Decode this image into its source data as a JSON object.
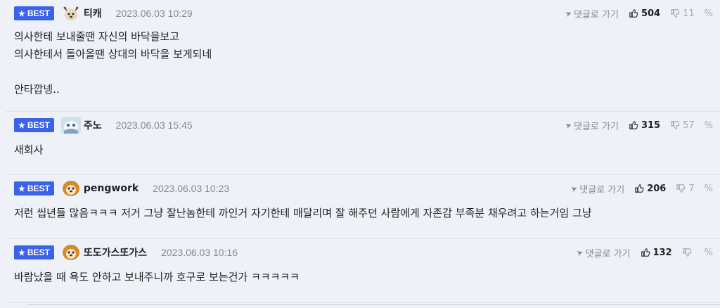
{
  "comments": [
    {
      "badge": "BEST",
      "nickname": "티캐",
      "date": "2023.06.03 10:29",
      "reply_label": "댓글로 가기",
      "likes": "504",
      "dislikes": "11",
      "body": "의사한테 보내줄땐 자신의 바닥을보고\n의사한테서 돌아올땐 상대의 바닥을 보게되네\n\n안타깝넹.."
    },
    {
      "badge": "BEST",
      "nickname": "주노",
      "date": "2023.06.03 15:45",
      "reply_label": "댓글로 가기",
      "likes": "315",
      "dislikes": "57",
      "body": "새회사"
    },
    {
      "badge": "BEST",
      "nickname": "pengwork",
      "date": "2023.06.03 10:23",
      "reply_label": "댓글로 가기",
      "likes": "206",
      "dislikes": "7",
      "body": "저런 씹년들 많음ㅋㅋㅋ 저거 그냥 잘난놈한테 까인거 자기한테 매달리며 잘 해주던 사람에게 자존감 부족분 채우려고 하는거임 그냥"
    },
    {
      "badge": "BEST",
      "nickname": "또도가스또가스",
      "date": "2023.06.03 10:16",
      "reply_label": "댓글로 가기",
      "likes": "132",
      "dislikes": "",
      "body": "바람났을 때 욕도 안하고 보내주니까 호구로 보는건가 ㅋㅋㅋㅋㅋ"
    }
  ],
  "colors": {
    "badge": "#3b63e8",
    "background": "#eef1f7"
  }
}
